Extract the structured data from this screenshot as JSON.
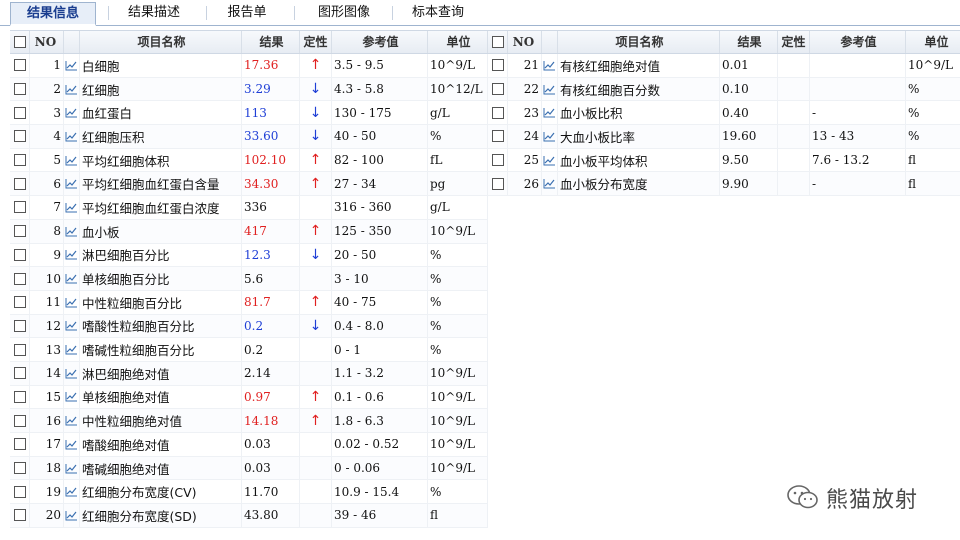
{
  "tabs": [
    {
      "label": "结果信息",
      "active": true
    },
    {
      "label": "结果描述",
      "active": false
    },
    {
      "label": "报告单",
      "active": false
    },
    {
      "label": "图形图像",
      "active": false
    },
    {
      "label": "标本查询",
      "active": false
    }
  ],
  "columns": {
    "no": "NO",
    "name": "项目名称",
    "result": "结果",
    "flag": "定性",
    "reference": "参考值",
    "unit": "单位"
  },
  "left_rows": [
    {
      "no": "1",
      "name": "白细胞",
      "result": "17.36",
      "status": "high",
      "flag": "↑",
      "reference": "3.5 - 9.5",
      "unit": "10^9/L"
    },
    {
      "no": "2",
      "name": "红细胞",
      "result": "3.29",
      "status": "low",
      "flag": "↓",
      "reference": "4.3 - 5.8",
      "unit": "10^12/L"
    },
    {
      "no": "3",
      "name": "血红蛋白",
      "result": "113",
      "status": "low",
      "flag": "↓",
      "reference": "130 - 175",
      "unit": "g/L"
    },
    {
      "no": "4",
      "name": "红细胞压积",
      "result": "33.60",
      "status": "low",
      "flag": "↓",
      "reference": "40 - 50",
      "unit": "%"
    },
    {
      "no": "5",
      "name": "平均红细胞体积",
      "result": "102.10",
      "status": "high",
      "flag": "↑",
      "reference": "82 - 100",
      "unit": "fL"
    },
    {
      "no": "6",
      "name": "平均红细胞血红蛋白含量",
      "result": "34.30",
      "status": "high",
      "flag": "↑",
      "reference": "27 - 34",
      "unit": "pg"
    },
    {
      "no": "7",
      "name": "平均红细胞血红蛋白浓度",
      "result": "336",
      "status": "normal",
      "flag": "",
      "reference": "316 - 360",
      "unit": "g/L"
    },
    {
      "no": "8",
      "name": "血小板",
      "result": "417",
      "status": "high",
      "flag": "↑",
      "reference": "125 - 350",
      "unit": "10^9/L"
    },
    {
      "no": "9",
      "name": "淋巴细胞百分比",
      "result": "12.3",
      "status": "low",
      "flag": "↓",
      "reference": "20 - 50",
      "unit": "%"
    },
    {
      "no": "10",
      "name": "单核细胞百分比",
      "result": "5.6",
      "status": "normal",
      "flag": "",
      "reference": "3 - 10",
      "unit": "%"
    },
    {
      "no": "11",
      "name": "中性粒细胞百分比",
      "result": "81.7",
      "status": "high",
      "flag": "↑",
      "reference": "40 - 75",
      "unit": "%"
    },
    {
      "no": "12",
      "name": "嗜酸性粒细胞百分比",
      "result": "0.2",
      "status": "low",
      "flag": "↓",
      "reference": "0.4 - 8.0",
      "unit": "%"
    },
    {
      "no": "13",
      "name": "嗜碱性粒细胞百分比",
      "result": "0.2",
      "status": "normal",
      "flag": "",
      "reference": "0 - 1",
      "unit": "%"
    },
    {
      "no": "14",
      "name": "淋巴细胞绝对值",
      "result": "2.14",
      "status": "normal",
      "flag": "",
      "reference": "1.1 - 3.2",
      "unit": "10^9/L"
    },
    {
      "no": "15",
      "name": "单核细胞绝对值",
      "result": "0.97",
      "status": "high",
      "flag": "↑",
      "reference": "0.1 - 0.6",
      "unit": "10^9/L"
    },
    {
      "no": "16",
      "name": "中性粒细胞绝对值",
      "result": "14.18",
      "status": "high",
      "flag": "↑",
      "reference": "1.8 - 6.3",
      "unit": "10^9/L"
    },
    {
      "no": "17",
      "name": "嗜酸细胞绝对值",
      "result": "0.03",
      "status": "normal",
      "flag": "",
      "reference": "0.02 - 0.52",
      "unit": "10^9/L"
    },
    {
      "no": "18",
      "name": "嗜碱细胞绝对值",
      "result": "0.03",
      "status": "normal",
      "flag": "",
      "reference": "0 - 0.06",
      "unit": "10^9/L"
    },
    {
      "no": "19",
      "name": "红细胞分布宽度(CV)",
      "result": "11.70",
      "status": "normal",
      "flag": "",
      "reference": "10.9 - 15.4",
      "unit": "%"
    },
    {
      "no": "20",
      "name": "红细胞分布宽度(SD)",
      "result": "43.80",
      "status": "normal",
      "flag": "",
      "reference": "39 - 46",
      "unit": "fl"
    }
  ],
  "right_rows": [
    {
      "no": "21",
      "name": "有核红细胞绝对值",
      "result": "0.01",
      "status": "normal",
      "flag": "",
      "reference": "",
      "unit": "10^9/L"
    },
    {
      "no": "22",
      "name": "有核红细胞百分数",
      "result": "0.10",
      "status": "normal",
      "flag": "",
      "reference": "",
      "unit": "%"
    },
    {
      "no": "23",
      "name": "血小板比积",
      "result": "0.40",
      "status": "normal",
      "flag": "",
      "reference": "-",
      "unit": "%"
    },
    {
      "no": "24",
      "name": "大血小板比率",
      "result": "19.60",
      "status": "normal",
      "flag": "",
      "reference": "13 - 43",
      "unit": "%"
    },
    {
      "no": "25",
      "name": "血小板平均体积",
      "result": "9.50",
      "status": "normal",
      "flag": "",
      "reference": "7.6 - 13.2",
      "unit": "fl"
    },
    {
      "no": "26",
      "name": "血小板分布宽度",
      "result": "9.90",
      "status": "normal",
      "flag": "",
      "reference": "-",
      "unit": "fl"
    }
  ],
  "icons": {
    "row_chart": "trend-chart-icon",
    "watermark": "wechat-icon"
  },
  "colors": {
    "high": "#e02020",
    "low": "#1f3fd6",
    "tab_active": "#1a3d8f"
  },
  "watermark": {
    "text": "熊猫放射"
  }
}
